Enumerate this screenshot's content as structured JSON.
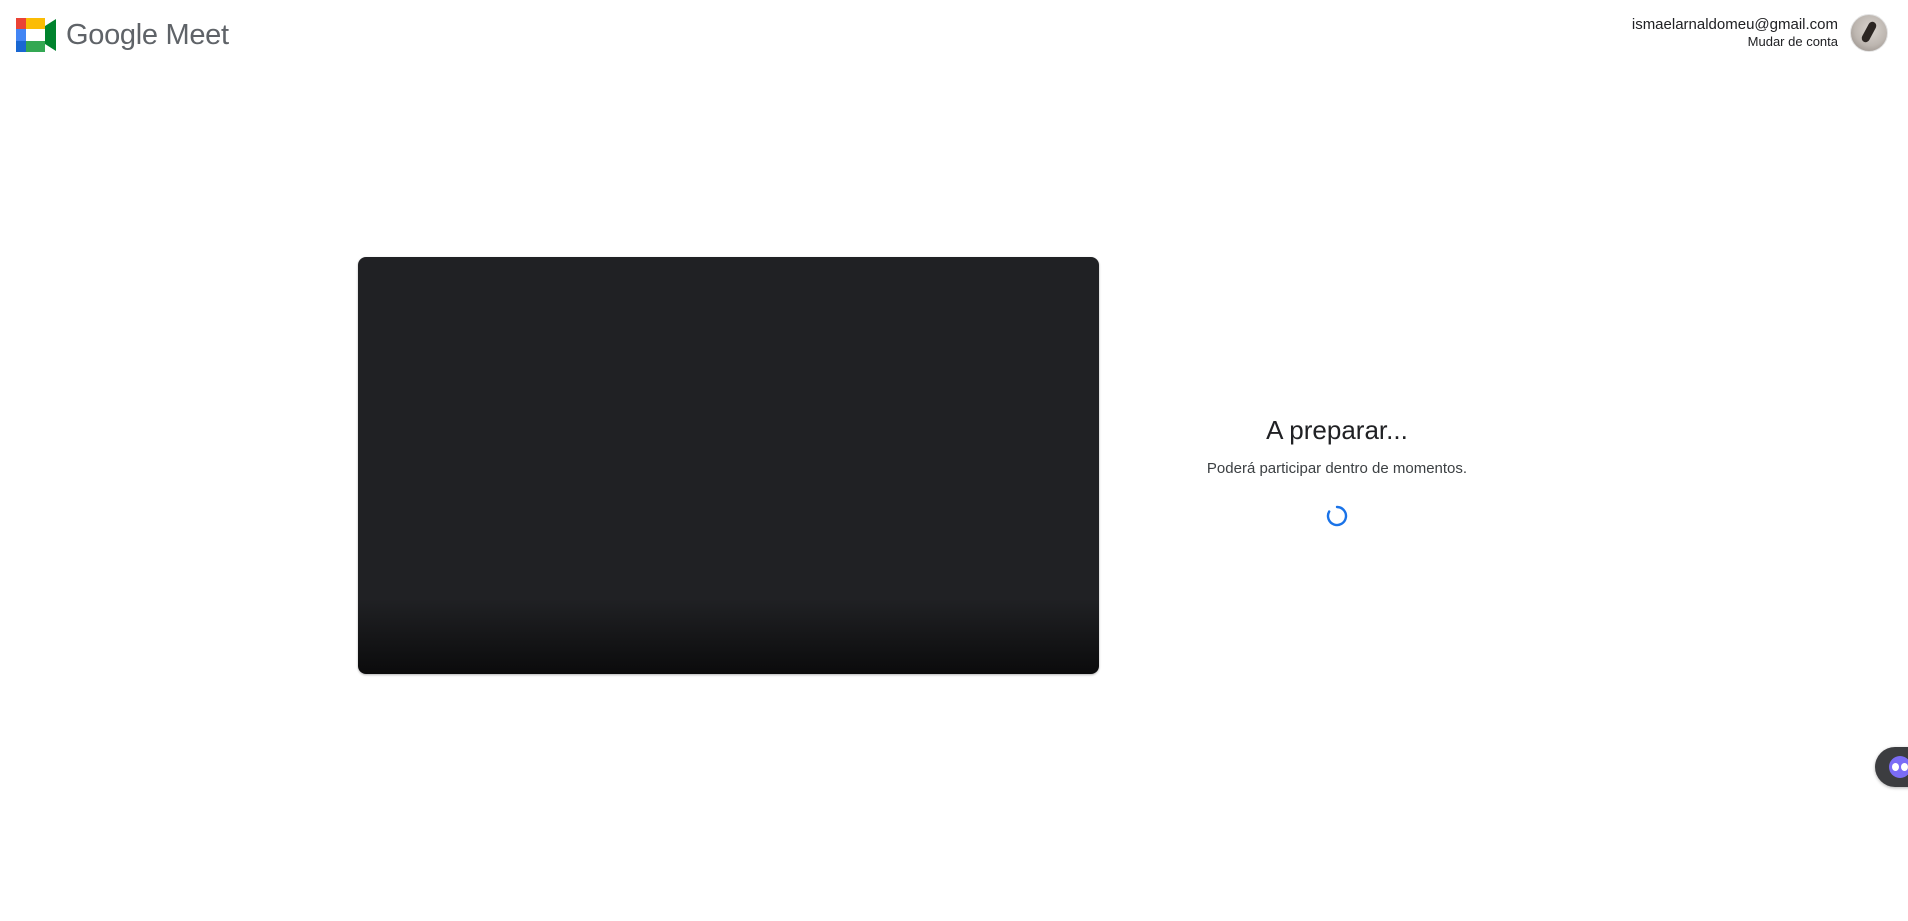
{
  "header": {
    "app_name": "Google Meet",
    "account_email": "ismaelarnaldomeu@gmail.com",
    "switch_account_label": "Mudar de conta"
  },
  "status": {
    "title": "A preparar...",
    "subtitle": "Poderá participar dentro de momentos."
  },
  "icons": {
    "logo": "google-meet-logo-icon",
    "spinner": "loading-spinner-icon",
    "widget": "assistant-widget-icon"
  },
  "colors": {
    "video_background": "#202124",
    "spinner": "#1a73e8",
    "logo_text": "#5f6368"
  }
}
